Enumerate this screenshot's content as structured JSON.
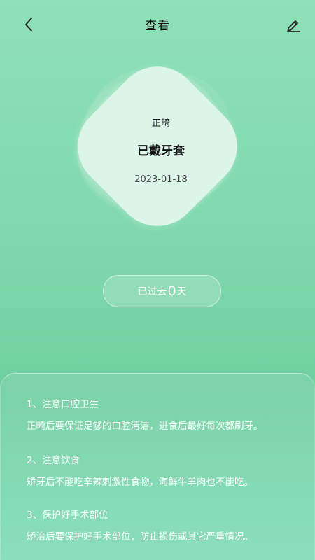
{
  "header": {
    "title": "查看",
    "back_icon": "chevron-left-icon",
    "edit_icon": "pencil-icon"
  },
  "card": {
    "label": "正畸",
    "status": "已戴牙套",
    "date": "2023-01-18"
  },
  "elapsed": {
    "prefix": "已过去",
    "count": "0",
    "suffix": "天"
  },
  "tips": [
    {
      "title": "1、注意口腔卫生",
      "body": "正畸后要保证足够的口腔清洁，进食后最好每次都刷牙。"
    },
    {
      "title": "2、注意饮食",
      "body": "矫牙后不能吃辛辣刺激性食物，海鲜牛羊肉也不能吃。"
    },
    {
      "title": "3、保护好手术部位",
      "body": "矫治后要保护好手术部位，防止损伤或其它严重情况。"
    }
  ],
  "colors": {
    "background_top": "#8ee0b7",
    "background_bottom": "#6fcf9f",
    "card": "#dcf5eb",
    "text_light": "#ffffff"
  }
}
